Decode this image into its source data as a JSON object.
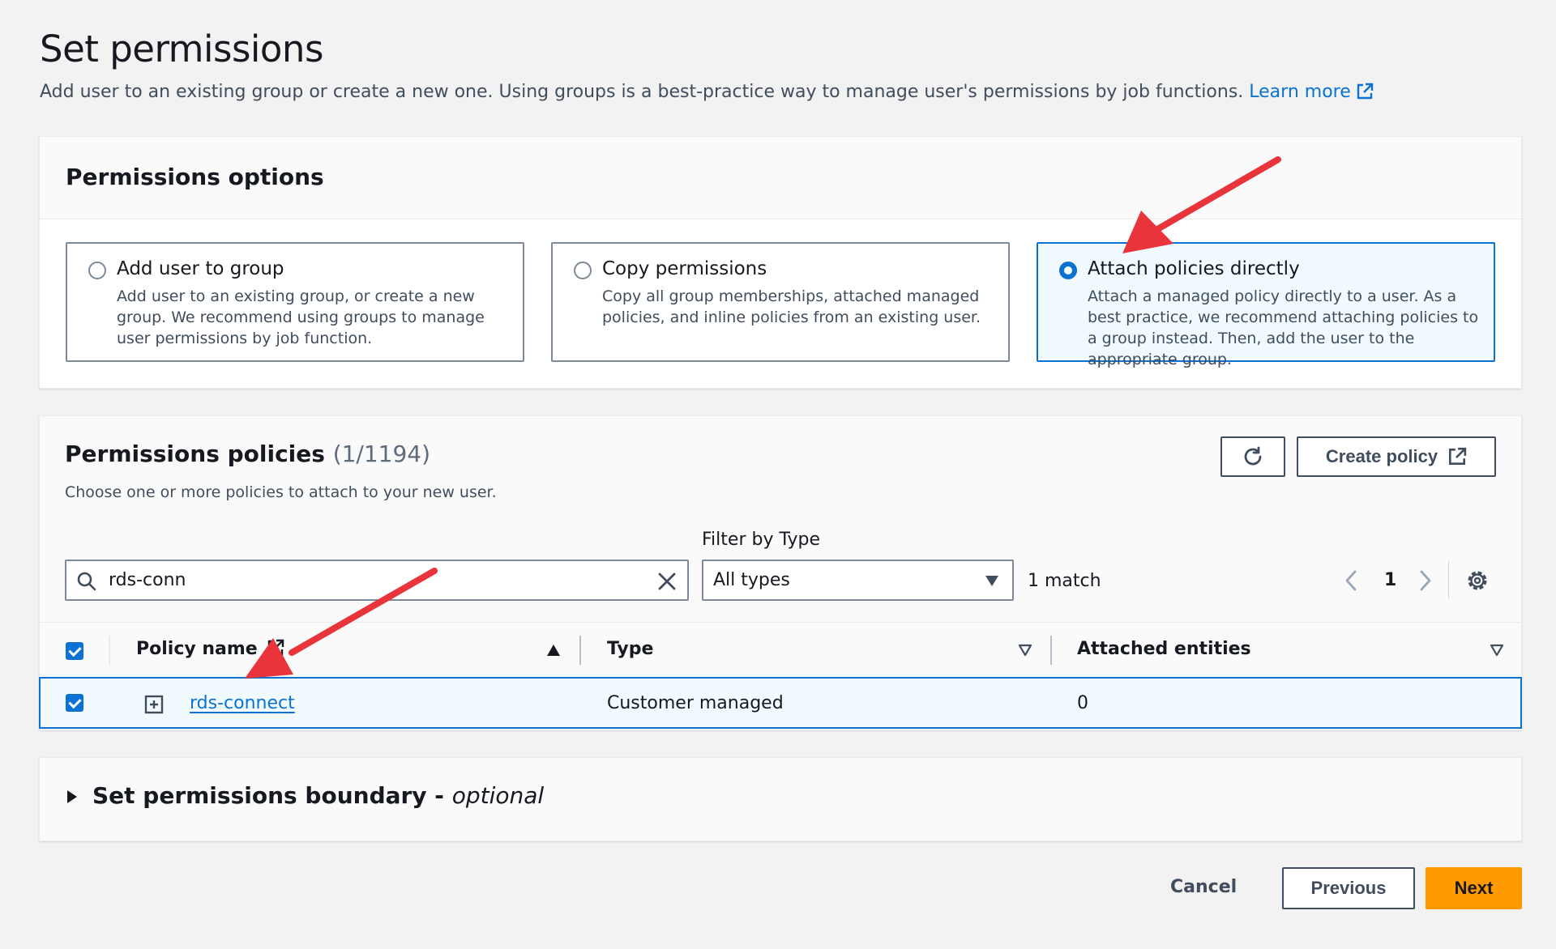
{
  "page": {
    "title": "Set permissions",
    "description": "Add user to an existing group or create a new one. Using groups is a best-practice way to manage user's permissions by job functions.",
    "learn_more": "Learn more"
  },
  "options": {
    "title": "Permissions options",
    "items": [
      {
        "title": "Add user to group",
        "desc": "Add user to an existing group, or create a new group. We recommend using groups to manage user permissions by job function."
      },
      {
        "title": "Copy permissions",
        "desc": "Copy all group memberships, attached managed policies, and inline policies from an existing user."
      },
      {
        "title": "Attach policies directly",
        "desc": "Attach a managed policy directly to a user. As a best practice, we recommend attaching policies to a group instead. Then, add the user to the appropriate group."
      }
    ],
    "selected_index": 2
  },
  "policies": {
    "title": "Permissions policies",
    "count": "(1/1194)",
    "description": "Choose one or more policies to attach to your new user.",
    "create_label": "Create policy",
    "filter_label": "Filter by Type",
    "search_value": "rds-conn",
    "filter_value": "All types",
    "match_text": "1 match",
    "page_number": "1",
    "columns": [
      "Policy name",
      "Type",
      "Attached entities"
    ],
    "rows": [
      {
        "name": "rds-connect",
        "type": "Customer managed",
        "entities": "0",
        "checked": true
      }
    ]
  },
  "boundary": {
    "title": "Set permissions boundary -",
    "optional": "optional"
  },
  "footer": {
    "cancel": "Cancel",
    "previous": "Previous",
    "next": "Next"
  },
  "colors": {
    "accent": "#0972d3",
    "primary_button": "#ff9900",
    "annotation_arrow": "#e8343a"
  }
}
